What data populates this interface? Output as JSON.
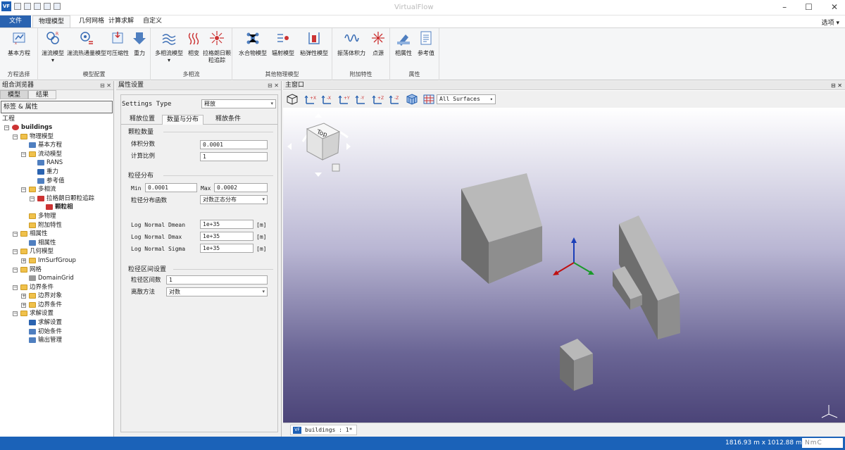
{
  "titlebar": {
    "logo": "VF",
    "title": "VirtualFlow"
  },
  "ribbon_tabs": [
    "文件",
    "物理模型",
    "几何网格",
    "计算求解",
    "自定义"
  ],
  "options_label": "选项",
  "ribbon": {
    "groups": [
      {
        "label": "方程选择",
        "buttons": [
          {
            "label": "基本方程",
            "icon": "equation-icon"
          }
        ]
      },
      {
        "label": "模型配置",
        "buttons": [
          {
            "label": "湍流模型",
            "icon": "turbulence-icon",
            "dropdown": true
          },
          {
            "label": "湍流热通量模型",
            "icon": "heat-flux-icon"
          },
          {
            "label": "可压缩性",
            "icon": "compressibility-icon"
          },
          {
            "label": "重力",
            "icon": "gravity-icon"
          }
        ]
      },
      {
        "label": "多相流",
        "buttons": [
          {
            "label": "多相流模型",
            "icon": "multiphase-icon",
            "dropdown": true
          },
          {
            "label": "相变",
            "icon": "phase-change-icon"
          },
          {
            "label": "拉格朗日颗粒追踪",
            "icon": "lagrangian-icon"
          }
        ]
      },
      {
        "label": "其他物理模型",
        "buttons": [
          {
            "label": "水合物模型",
            "icon": "hydrate-icon"
          },
          {
            "label": "辐射模型",
            "icon": "radiation-icon"
          },
          {
            "label": "粘弹性模型",
            "icon": "viscoelastic-icon"
          }
        ]
      },
      {
        "label": "附加特性",
        "buttons": [
          {
            "label": "振荡体积力",
            "icon": "oscillation-icon"
          },
          {
            "label": "点源",
            "icon": "point-source-icon"
          }
        ]
      },
      {
        "label": "属性",
        "buttons": [
          {
            "label": "相属性",
            "icon": "phase-property-icon"
          },
          {
            "label": "参考值",
            "icon": "reference-icon"
          }
        ]
      }
    ]
  },
  "left_panel": {
    "title": "组合浏览器",
    "tabs": [
      "模型",
      "结果"
    ],
    "tag_label": "标签 & 属性",
    "root_label": "工程",
    "tree": [
      {
        "label": "buildings",
        "level": 0,
        "expander": "-",
        "icon": "project",
        "bold": true
      },
      {
        "label": "物理模型",
        "level": 1,
        "expander": "-",
        "icon": "folder"
      },
      {
        "label": "基本方程",
        "level": 2,
        "icon": "equation"
      },
      {
        "label": "流动模型",
        "level": 2,
        "expander": "-",
        "icon": "folder"
      },
      {
        "label": "RANS",
        "level": 3,
        "icon": "turbulence"
      },
      {
        "label": "重力",
        "level": 3,
        "icon": "gravity"
      },
      {
        "label": "参考值",
        "level": 3,
        "icon": "reference"
      },
      {
        "label": "多相流",
        "level": 2,
        "expander": "-",
        "icon": "folder"
      },
      {
        "label": "拉格朗日颗粒追踪",
        "level": 3,
        "expander": "-",
        "icon": "lagrangian"
      },
      {
        "label": "颗粒相",
        "level": 4,
        "icon": "particle",
        "bold": true
      },
      {
        "label": "多物理",
        "level": 2,
        "icon": "folder"
      },
      {
        "label": "附加特性",
        "level": 2,
        "icon": "folder"
      },
      {
        "label": "相属性",
        "level": 1,
        "expander": "-",
        "icon": "folder"
      },
      {
        "label": "相属性",
        "level": 2,
        "icon": "phase"
      },
      {
        "label": "几何模型",
        "level": 1,
        "expander": "-",
        "icon": "folder"
      },
      {
        "label": "ImSurfGroup",
        "level": 2,
        "expander": "+",
        "icon": "folder"
      },
      {
        "label": "网格",
        "level": 1,
        "expander": "-",
        "icon": "folder"
      },
      {
        "label": "DomainGrid",
        "level": 2,
        "icon": "grid"
      },
      {
        "label": "边界条件",
        "level": 1,
        "expander": "-",
        "icon": "folder"
      },
      {
        "label": "边界对象",
        "level": 2,
        "expander": "+",
        "icon": "folder"
      },
      {
        "label": "边界条件",
        "level": 2,
        "expander": "+",
        "icon": "folder"
      },
      {
        "label": "求解设置",
        "level": 1,
        "expander": "-",
        "icon": "folder"
      },
      {
        "label": "求解设置",
        "level": 2,
        "icon": "solver"
      },
      {
        "label": "初始条件",
        "level": 2,
        "icon": "initial"
      },
      {
        "label": "输出管理",
        "level": 2,
        "icon": "output"
      }
    ]
  },
  "props_panel": {
    "title": "属性设置",
    "settings_type_label": "Settings Type",
    "settings_type_value": "释放",
    "tabs": [
      "释放位置",
      "数量与分布",
      "释放条件"
    ],
    "particle_count": {
      "title": "颗粒数量",
      "volume_fraction_label": "体积分数",
      "volume_fraction_value": "0.0001",
      "calc_ratio_label": "计算比例",
      "calc_ratio_value": "1"
    },
    "size_distribution": {
      "title": "粒径分布",
      "min_label": "Min",
      "min_value": "0.0001",
      "max_label": "Max",
      "max_value": "0.0002",
      "func_label": "粒径分布函数",
      "func_value": "对数正态分布",
      "rows": [
        {
          "label": "Log Normal Dmean",
          "value": "1e+35",
          "unit": "[m]"
        },
        {
          "label": "Log Normal Dmax",
          "value": "1e+35",
          "unit": "[m]"
        },
        {
          "label": "Log Normal Sigma",
          "value": "1e+35",
          "unit": "[m]"
        }
      ]
    },
    "interval": {
      "title": "粒径区间设置",
      "count_label": "粒径区间数",
      "count_value": "1",
      "method_label": "离散方法",
      "method_value": "对数"
    }
  },
  "viewport": {
    "title": "主窗口",
    "surface_filter": "All Surfaces",
    "navcube_face": "Top",
    "doc_tab_logo": "VF",
    "doc_tab": "buildings : 1*",
    "colors": {
      "box_light": "#b9b9b9",
      "box_dark": "#6e6e6e",
      "box_side": "#8e8e8e"
    }
  },
  "status": {
    "dimensions": "1816.93 m x 1012.88 m",
    "unit": "NmC"
  }
}
